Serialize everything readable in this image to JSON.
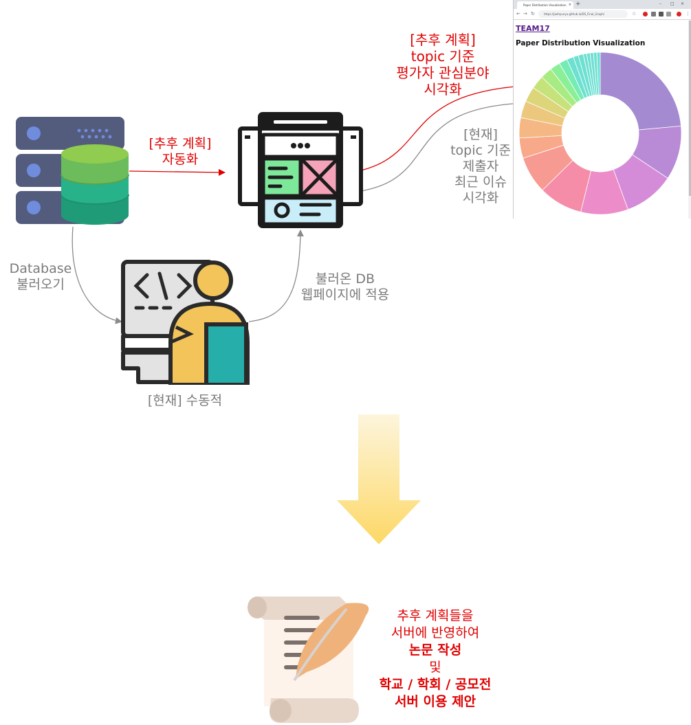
{
  "labels": {
    "auto_plan": [
      "[추후 계획]",
      "자동화"
    ],
    "future_viz": [
      "[추후 계획]",
      "topic 기준",
      "평가자 관심분야",
      "시각화"
    ],
    "current_viz": [
      "[현재]",
      "topic 기준",
      "제출자",
      "최근 이슈",
      "시각화"
    ],
    "db_load": [
      "Database",
      "불러오기"
    ],
    "apply_db": [
      "불러온 DB",
      "웹페이지에 적용"
    ],
    "current_manual": "[현재] 수동적",
    "conclusion": [
      "추후 계획들을",
      "서버에 반영하여",
      "논문 작성",
      "및",
      "학교 / 학회 / 공모전",
      "서버 이용 제안"
    ]
  },
  "browser": {
    "tab_title": "Paper Distribution Visualization",
    "url": "https://jaehyunyu.github.io/DS_Final_Graph/",
    "link_text": "TEAM17",
    "page_heading": "Paper Distribution Visualization"
  },
  "colors": {
    "red": "#e00000",
    "gray": "#7a7a7a",
    "arrow_gradient_top": "#fdf4d6",
    "arrow_gradient_bottom": "#fddc6a"
  },
  "icons": [
    "database-server-icon",
    "webpage-wireframe-icon",
    "developer-at-computer-icon",
    "scroll-quill-icon",
    "down-arrow-icon"
  ],
  "sunburst_colors": [
    "#a48ad1",
    "#b98ad6",
    "#d48cd8",
    "#ec8cc9",
    "#f58ca8",
    "#f79a92",
    "#f7a98a",
    "#f5b884",
    "#ecc77e",
    "#dcd579",
    "#c6e27a",
    "#a9eb83",
    "#8aef96",
    "#74ecb4",
    "#6ee0d2"
  ]
}
